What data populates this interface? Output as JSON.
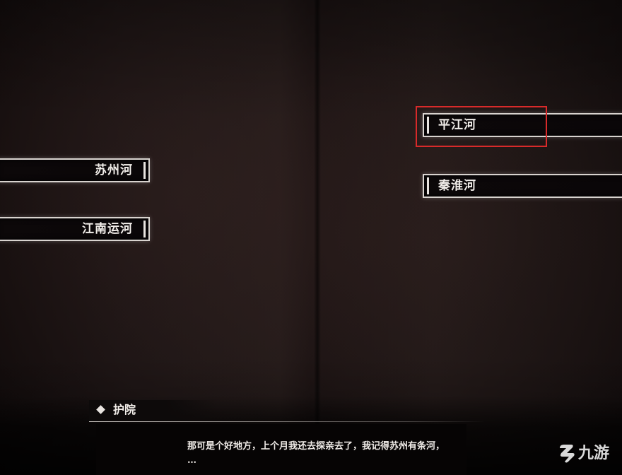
{
  "choices": {
    "left": [
      {
        "label": "苏州河"
      },
      {
        "label": "江南运河"
      }
    ],
    "right": [
      {
        "label": "平江河",
        "highlighted": true
      },
      {
        "label": "秦淮河"
      }
    ]
  },
  "dialog": {
    "speaker": "护院",
    "text": "那可是个好地方，上个月我还去探亲去了，我记得苏州有条河，\n…"
  },
  "watermark": {
    "text": "九游",
    "icon": "jiuyou-logo-icon"
  },
  "colors": {
    "highlight_border": "#d82a2a",
    "choice_border": "#d8d3cf",
    "text": "#f2eeea"
  }
}
